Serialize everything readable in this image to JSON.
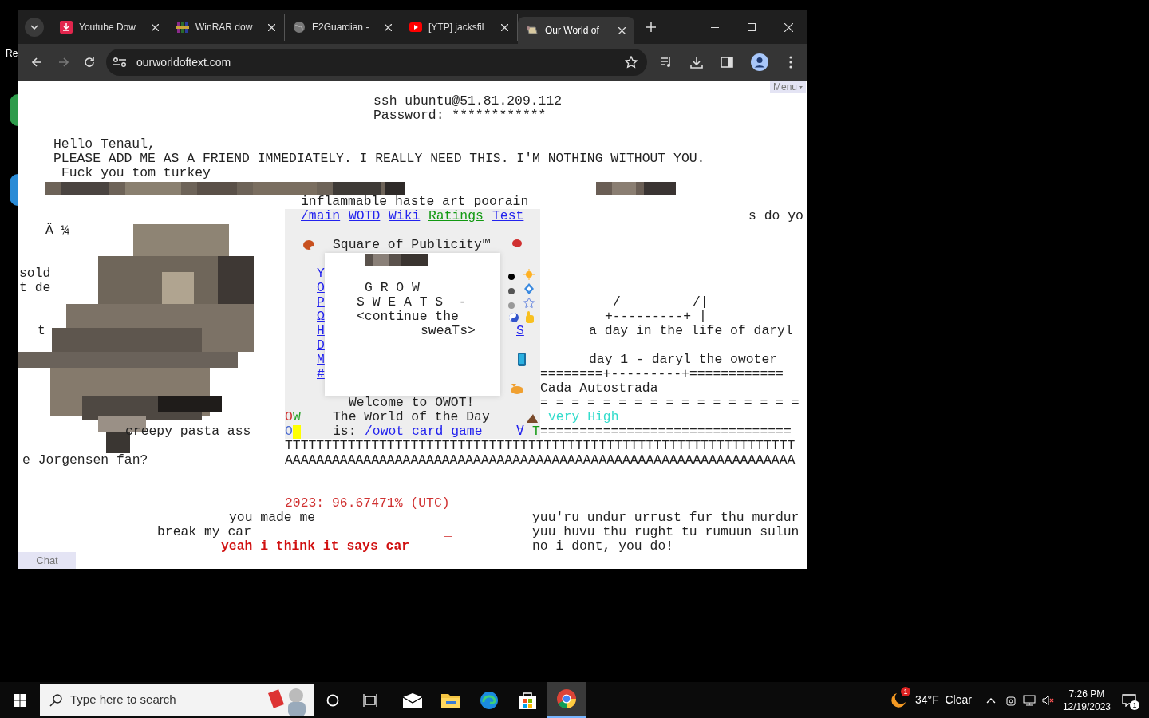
{
  "desktop": {
    "icon_labels": [
      "Re"
    ]
  },
  "browser": {
    "tabs": [
      {
        "title": "Youtube Dow",
        "selected": false
      },
      {
        "title": "WinRAR dow",
        "selected": false
      },
      {
        "title": "E2Guardian -",
        "selected": false
      },
      {
        "title": "[YTP] jacksfil",
        "selected": false
      },
      {
        "title": "Our World of",
        "selected": true
      }
    ],
    "address": "ourworldoftext.com"
  },
  "page": {
    "menu_button": "Menu",
    "chat_button": "Chat",
    "texts": [
      {
        "text": "ssh ubuntu@51.81.209.112",
        "kind": "plain"
      },
      {
        "text": "Password: ************",
        "kind": "plain"
      },
      {
        "text": "Hello Tenaul,",
        "kind": "plain"
      },
      {
        "text": "PLEASE ADD ME AS A FRIEND IMMEDIATELY. I REALLY NEED THIS. I'M NOTHING WITHOUT YOU.",
        "kind": "plain"
      },
      {
        "text": "Fuck you tom turkey",
        "kind": "plain"
      },
      {
        "text": "inflammable haste art poorain",
        "kind": "plain"
      },
      {
        "text": "/main",
        "kind": "link"
      },
      {
        "text": "WOTD",
        "kind": "link"
      },
      {
        "text": "Wiki",
        "kind": "link"
      },
      {
        "text": "Ratings",
        "kind": "green_link"
      },
      {
        "text": "Test",
        "kind": "link"
      },
      {
        "text": "s do yo",
        "kind": "plain"
      },
      {
        "text": "Ä ¼",
        "kind": "plain"
      },
      {
        "text": "Square of Publicity™",
        "kind": "plain"
      },
      {
        "text": "sold",
        "kind": "plain"
      },
      {
        "text": "t de",
        "kind": "plain"
      },
      {
        "text": "t",
        "kind": "plain"
      },
      {
        "text": "G R O W",
        "kind": "plain"
      },
      {
        "text": "S W E A T S  -",
        "kind": "plain"
      },
      {
        "text": "<continue the",
        "kind": "plain"
      },
      {
        "text": "sweaTs>",
        "kind": "plain"
      },
      {
        "text": "Y",
        "kind": "link"
      },
      {
        "text": "O",
        "kind": "link"
      },
      {
        "text": "P",
        "kind": "link"
      },
      {
        "text": "Ω",
        "kind": "link"
      },
      {
        "text": "H",
        "kind": "link"
      },
      {
        "text": "D",
        "kind": "link"
      },
      {
        "text": "M",
        "kind": "link"
      },
      {
        "text": "#",
        "kind": "link"
      },
      {
        "text": "S",
        "kind": "link"
      },
      {
        "text": "/",
        "kind": "plain"
      },
      {
        "text": "/|",
        "kind": "plain"
      },
      {
        "text": "+---------+ |",
        "kind": "plain"
      },
      {
        "text": "a day in the life of daryl",
        "kind": "plain"
      },
      {
        "text": "day 1 - daryl the owoter",
        "kind": "plain"
      },
      {
        "text": "========+---------+============",
        "kind": "plain"
      },
      {
        "text": "Cada Autostrada",
        "kind": "plain"
      },
      {
        "text": "Welcome to OWOT!",
        "kind": "plain"
      },
      {
        "text": "= = = = = = = = = = = = = = = = =",
        "kind": "plain"
      },
      {
        "text": "O",
        "kind": "red"
      },
      {
        "text": "W",
        "kind": "green"
      },
      {
        "text": "The World of the Day",
        "kind": "plain"
      },
      {
        "text": "very High",
        "kind": "cyan"
      },
      {
        "text": "O",
        "kind": "blue"
      },
      {
        "text": "creepy pasta ass",
        "kind": "plain"
      },
      {
        "text": "is:",
        "kind": "plain"
      },
      {
        "text": "/owot_card_game",
        "kind": "link"
      },
      {
        "text": "∀",
        "kind": "link"
      },
      {
        "text": "T",
        "kind": "green_link"
      },
      {
        "text": "================================",
        "kind": "plain"
      },
      {
        "text": "TTTTTTTTTTTTTTTTTTTTTTTTTTTTTTTTTTTTTTTTTTTTTTTTTTTTTTTTTTTTTTTTT",
        "kind": "plain"
      },
      {
        "text": "e Jorgensen fan?",
        "kind": "plain"
      },
      {
        "text": "AAAAAAAAAAAAAAAAAAAAAAAAAAAAAAAAAAAAAAAAAAAAAAAAAAAAAAAAAAAAAAAAA",
        "kind": "plain"
      },
      {
        "text": "2023: 96.67471% (UTC)",
        "kind": "red"
      },
      {
        "text": "you made me",
        "kind": "plain"
      },
      {
        "text": "yuu'ru undur urrust fur thu murdur",
        "kind": "plain"
      },
      {
        "text": "break my car",
        "kind": "plain"
      },
      {
        "text": "_",
        "kind": "red"
      },
      {
        "text": "yuu huvu thu rught tu rumuun sulun",
        "kind": "plain"
      },
      {
        "text": "yeah i think it says car",
        "kind": "bold_red"
      },
      {
        "text": "no i dont, you do!",
        "kind": "plain"
      }
    ]
  },
  "taskbar": {
    "search_placeholder": "Type here to search",
    "weather": "34°F  Clear",
    "weather_badge": "1",
    "time": "7:26 PM",
    "date": "12/19/2023",
    "notification_count": "1"
  }
}
